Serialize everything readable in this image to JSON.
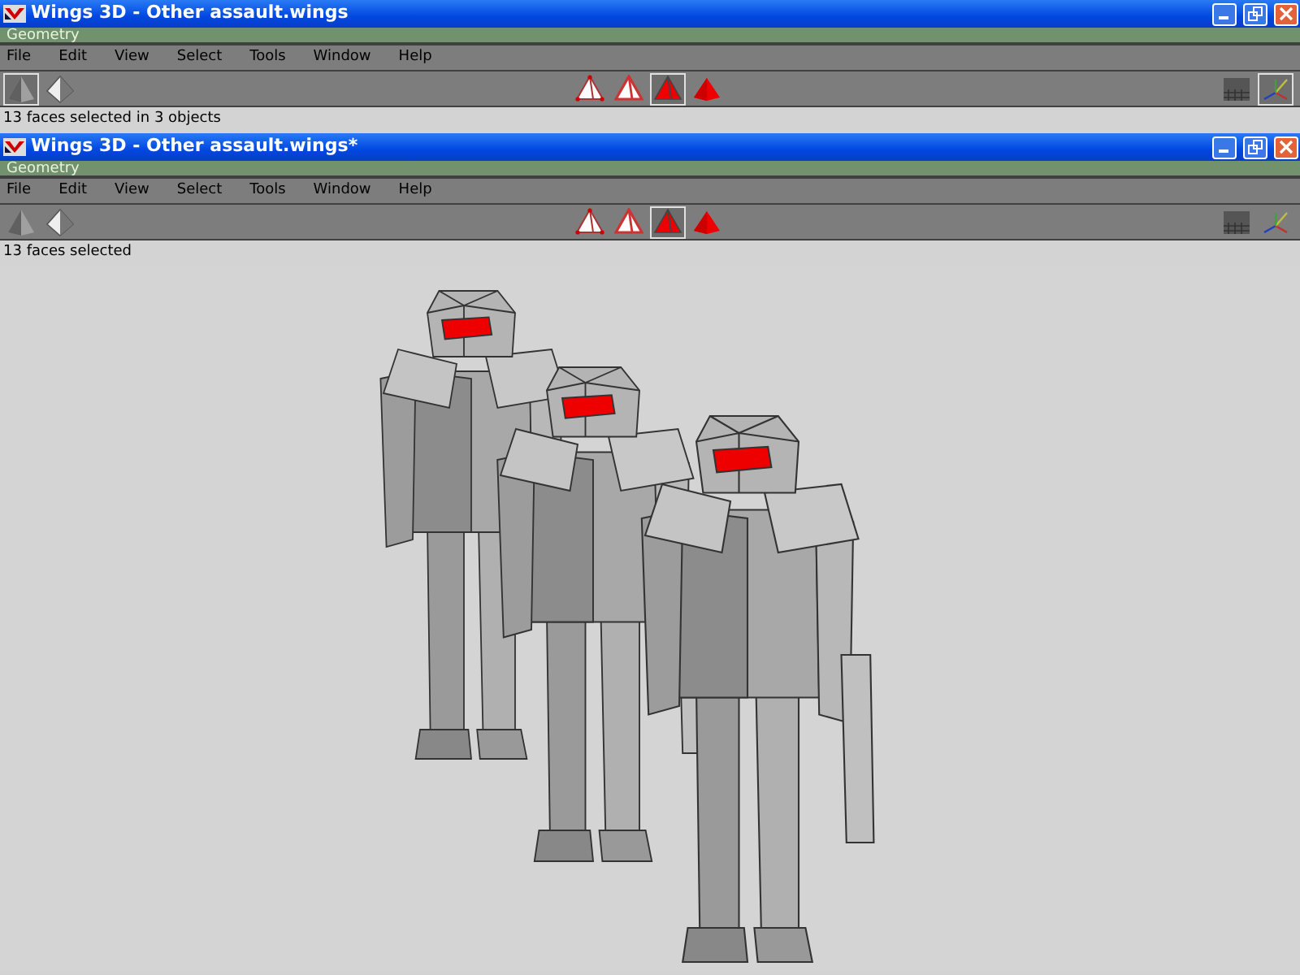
{
  "windows": [
    {
      "title": "Wings 3D - Other assault.wings",
      "active": true,
      "panel_title": "Geometry",
      "menu": [
        "File",
        "Edit",
        "View",
        "Select",
        "Tools",
        "Window",
        "Help"
      ],
      "toolbar_left": [
        {
          "kind": "smooth",
          "selected": true
        },
        {
          "kind": "wire",
          "selected": false
        }
      ],
      "toolbar_modes": [
        {
          "kind": "vertex",
          "selected": false
        },
        {
          "kind": "edge",
          "selected": false
        },
        {
          "kind": "face",
          "selected": true
        },
        {
          "kind": "body",
          "selected": false
        }
      ],
      "toolbar_right": [
        {
          "kind": "ground",
          "selected": false
        },
        {
          "kind": "axes",
          "selected": true
        }
      ],
      "status": "13 faces selected in 3 objects"
    },
    {
      "title": "Wings 3D - Other assault.wings*",
      "active": true,
      "panel_title": "Geometry",
      "menu": [
        "File",
        "Edit",
        "View",
        "Select",
        "Tools",
        "Window",
        "Help"
      ],
      "toolbar_left": [
        {
          "kind": "smooth",
          "selected": false
        },
        {
          "kind": "wire",
          "selected": false
        }
      ],
      "toolbar_modes": [
        {
          "kind": "vertex",
          "selected": false
        },
        {
          "kind": "edge",
          "selected": false
        },
        {
          "kind": "face",
          "selected": true
        },
        {
          "kind": "body",
          "selected": false
        }
      ],
      "toolbar_right": [
        {
          "kind": "ground",
          "selected": false
        },
        {
          "kind": "axes",
          "selected": false
        }
      ],
      "status": "13 faces selected"
    }
  ]
}
